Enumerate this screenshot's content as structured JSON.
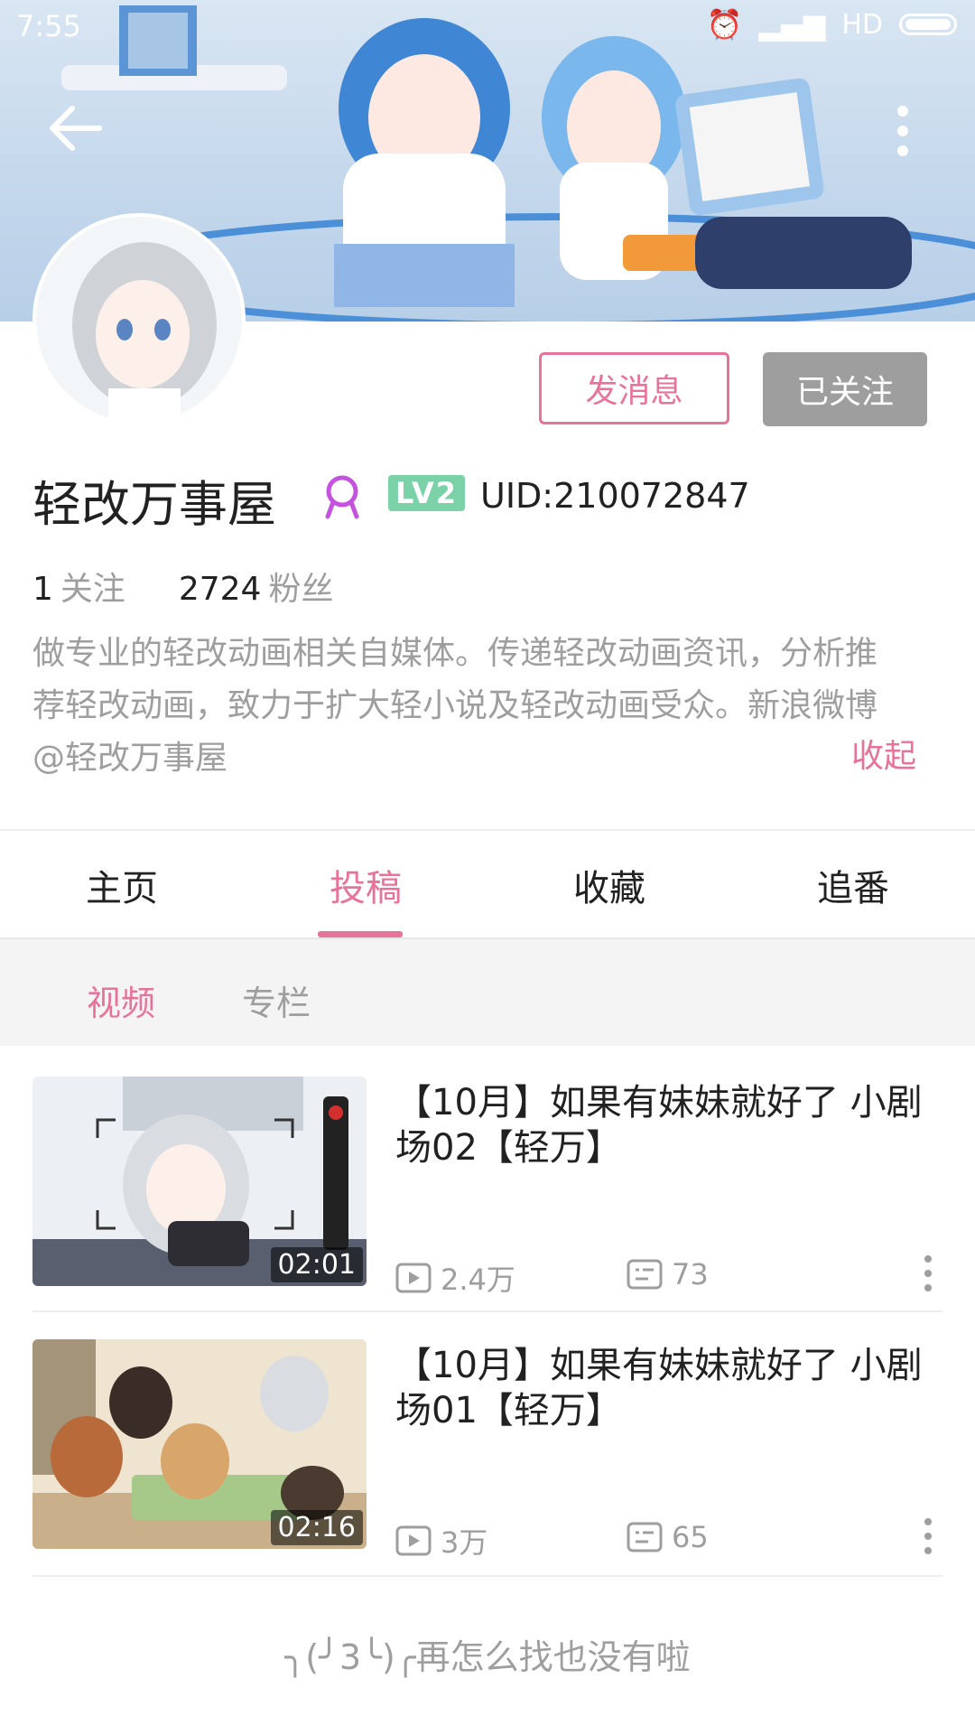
{
  "status_bar": {
    "time": "7:55",
    "network": "HD"
  },
  "profile": {
    "actions": {
      "message": "发消息",
      "followed": "已关注"
    },
    "name": "轻改万事屋",
    "level": "LV2",
    "uid": "UID:210072847",
    "stats": {
      "following_count": "1",
      "following_label": "关注",
      "fans_count": "2724",
      "fans_label": "粉丝"
    },
    "bio_line1": "做专业的轻改动画相关自媒体。传递轻改动画资讯，分析推",
    "bio_line2": "荐轻改动画，致力于扩大轻小说及轻改动画受众。新浪微博",
    "bio_line3": "@轻改万事屋",
    "collapse": "收起"
  },
  "tabs": [
    "主页",
    "投稿",
    "收藏",
    "追番"
  ],
  "active_tab": "投稿",
  "subtabs": [
    "视频",
    "专栏"
  ],
  "videos": [
    {
      "title_line1": "【10月】如果有妹妹就好了 小剧",
      "title_line2": "场02【轻万】",
      "duration": "02:01",
      "views": "2.4万",
      "danmaku": "73"
    },
    {
      "title_line1": "【10月】如果有妹妹就好了 小剧",
      "title_line2": "场01【轻万】",
      "duration": "02:16",
      "views": "3万",
      "danmaku": "65"
    }
  ],
  "footer_note": "╮(╯3╰)╭再怎么找也没有啦",
  "colors": {
    "accent": "#e8739a",
    "followed_bg": "#9e9e9e",
    "level_badge": "#7bd2a8"
  }
}
